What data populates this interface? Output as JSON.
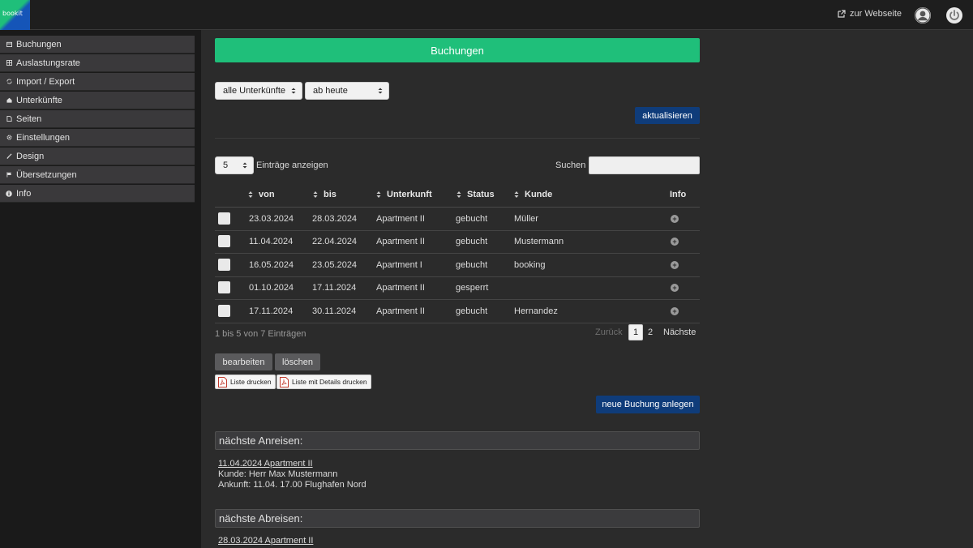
{
  "app": {
    "logo_text": "bookit"
  },
  "topbar": {
    "website_link": "zur Webseite"
  },
  "sidebar": {
    "items": [
      {
        "label": "Buchungen",
        "icon": "calendar-icon"
      },
      {
        "label": "Auslastungsrate",
        "icon": "grid-icon"
      },
      {
        "label": "Import / Export",
        "icon": "sync-icon"
      },
      {
        "label": "Unterkünfte",
        "icon": "home-icon"
      },
      {
        "label": "Seiten",
        "icon": "page-icon"
      },
      {
        "label": "Einstellungen",
        "icon": "gear-icon"
      },
      {
        "label": "Design",
        "icon": "brush-icon"
      },
      {
        "label": "Übersetzungen",
        "icon": "flag-icon"
      },
      {
        "label": "Info",
        "icon": "info-icon"
      }
    ]
  },
  "main": {
    "title": "Buchungen",
    "filter_accommodation": "alle Unterkünfte",
    "filter_date": "ab heute",
    "refresh_label": "aktualisieren",
    "page_size": "5",
    "page_size_label": "Einträge anzeigen",
    "search_label": "Suchen",
    "table": {
      "headers": [
        "von",
        "bis",
        "Unterkunft",
        "Status",
        "Kunde",
        "Info"
      ],
      "rows": [
        {
          "von": "23.03.2024",
          "bis": "28.03.2024",
          "unterkunft": "Apartment II",
          "status": "gebucht",
          "kunde": "Müller"
        },
        {
          "von": "11.04.2024",
          "bis": "22.04.2024",
          "unterkunft": "Apartment II",
          "status": "gebucht",
          "kunde": "Mustermann"
        },
        {
          "von": "16.05.2024",
          "bis": "23.05.2024",
          "unterkunft": "Apartment I",
          "status": "gebucht",
          "kunde": "booking"
        },
        {
          "von": "01.10.2024",
          "bis": "17.11.2024",
          "unterkunft": "Apartment II",
          "status": "gesperrt",
          "kunde": ""
        },
        {
          "von": "17.11.2024",
          "bis": "30.11.2024",
          "unterkunft": "Apartment II",
          "status": "gebucht",
          "kunde": "Hernandez"
        }
      ]
    },
    "table_info": "1 bis 5 von 7 Einträgen",
    "pagination": {
      "prev": "Zurück",
      "pages": [
        "1",
        "2"
      ],
      "current": "1",
      "next": "Nächste"
    },
    "edit_label": "bearbeiten",
    "delete_label": "löschen",
    "print_list": "Liste drucken",
    "print_details": "Liste mit Details drucken",
    "new_booking_label": "neue Buchung anlegen",
    "arrivals": {
      "title": "nächste Anreisen:",
      "link": "11.04.2024 Apartment II",
      "lines": [
        "Kunde: Herr Max Mustermann",
        "Ankunft: 11.04. 17.00 Flughafen Nord"
      ]
    },
    "departures": {
      "title": "nächste Abreisen:",
      "link": "28.03.2024 Apartment II"
    }
  }
}
